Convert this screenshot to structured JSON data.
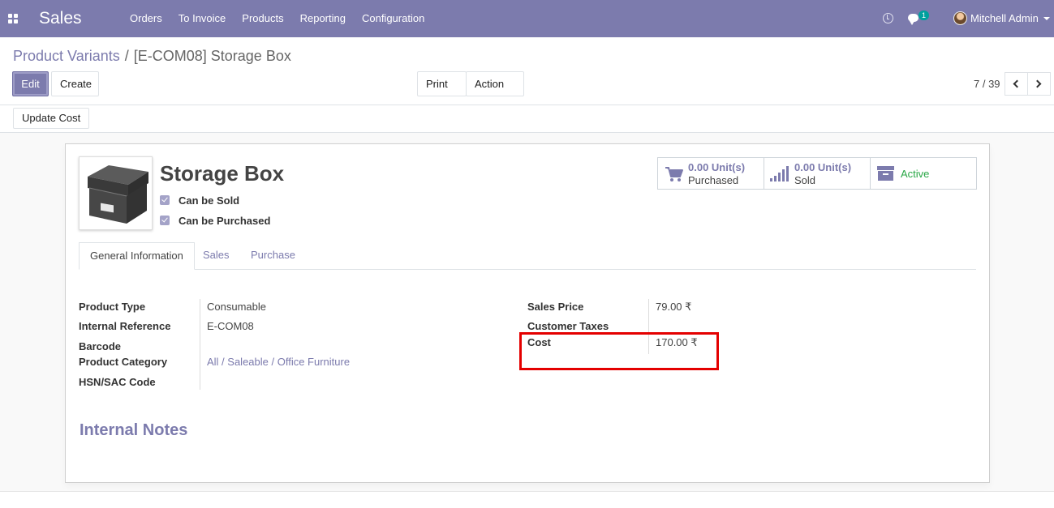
{
  "navbar": {
    "app_name": "Sales",
    "menu": [
      "Orders",
      "To Invoice",
      "Products",
      "Reporting",
      "Configuration"
    ],
    "chat_count": "1",
    "user": "Mitchell Admin",
    "icons": [
      "apps-icon",
      "clock-icon",
      "chat-icon",
      "avatar"
    ]
  },
  "breadcrumb": {
    "parent": "Product Variants",
    "separator": "/",
    "current": "[E-COM08] Storage Box"
  },
  "toolbar": {
    "edit_label": "Edit",
    "create_label": "Create",
    "print_label": "Print",
    "action_label": "Action",
    "pager": "7 / 39"
  },
  "statusbar": {
    "update_cost_label": "Update Cost"
  },
  "product": {
    "name": "Storage Box",
    "can_be_sold_label": "Can be Sold",
    "can_be_purchased_label": "Can be Purchased",
    "can_be_sold": true,
    "can_be_purchased": true
  },
  "smart_buttons": {
    "purchased_value": "0.00 Unit(s)",
    "purchased_label": "Purchased",
    "sold_value": "0.00 Unit(s)",
    "sold_label": "Sold",
    "active_label": "Active"
  },
  "tabs": [
    "General Information",
    "Sales",
    "Purchase"
  ],
  "left_fields": {
    "product_type_label": "Product Type",
    "product_type": "Consumable",
    "internal_reference_label": "Internal Reference",
    "internal_reference": "E-COM08",
    "barcode_label": "Barcode",
    "barcode": "",
    "product_category_label": "Product Category",
    "product_category": "All / Saleable / Office Furniture",
    "hsn_label": "HSN/SAC Code",
    "hsn": ""
  },
  "right_fields": {
    "sales_price_label": "Sales Price",
    "sales_price": "79.00 ₹",
    "customer_taxes_label": "Customer Taxes",
    "customer_taxes": "",
    "cost_label": "Cost",
    "cost": "170.00 ₹"
  },
  "internal_notes_title": "Internal Notes",
  "colors": {
    "brand": "#7c7bad",
    "active": "#28a745",
    "highlight": "#e40000"
  }
}
